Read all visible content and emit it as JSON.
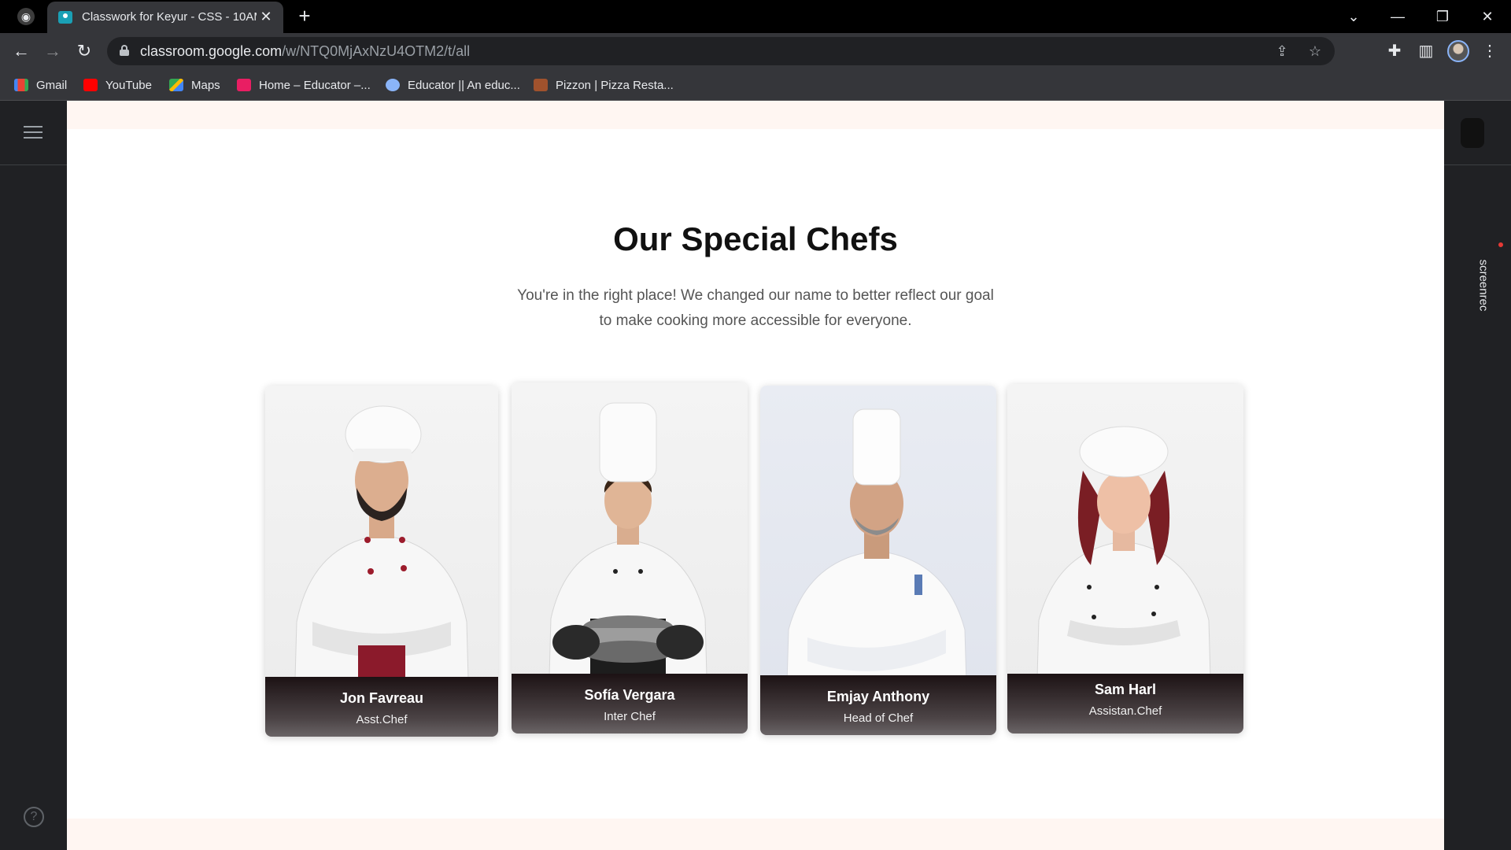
{
  "browser": {
    "tab_title": "Classwork for Keyur - CSS - 10AM",
    "url_host": "classroom.google.com",
    "url_path": "/w/NTQ0MjAxNzU4OTM2/t/all",
    "bookmarks": [
      {
        "label": "Gmail",
        "icon": "gmail-icon",
        "color": "#d93025"
      },
      {
        "label": "YouTube",
        "icon": "youtube-icon",
        "color": "#ff0000"
      },
      {
        "label": "Maps",
        "icon": "maps-icon",
        "color": "#34a853"
      },
      {
        "label": "Home – Educator –...",
        "icon": "educator-icon",
        "color": "#e91e63"
      },
      {
        "label": "Educator || An educ...",
        "icon": "globe-icon",
        "color": "#8ab4f8"
      },
      {
        "label": "Pizzon | Pizza Resta...",
        "icon": "pizzon-icon",
        "color": "#a0522d"
      }
    ]
  },
  "section": {
    "title": "Our Special Chefs",
    "subtitle": "You're in the right place! We changed our name to better reflect our goal to make cooking more accessible for everyone."
  },
  "chefs": [
    {
      "name": "Jon Favreau",
      "role": "Asst.Chef",
      "apron": "#8b1a2b",
      "buttons": "#9c1c2c"
    },
    {
      "name": "Sofía Vergara",
      "role": "Inter Chef",
      "apron": "#1d1d1d",
      "buttons": "#222222"
    },
    {
      "name": "Emjay Anthony",
      "role": "Head of Chef",
      "apron": "#ffffff",
      "buttons": "#5a7bb5"
    },
    {
      "name": "Sam Harl",
      "role": "Assistan.Chef",
      "apron": "#ffffff",
      "buttons": "#222222"
    }
  ],
  "overlay": {
    "screenrec_label": "screenrec"
  }
}
